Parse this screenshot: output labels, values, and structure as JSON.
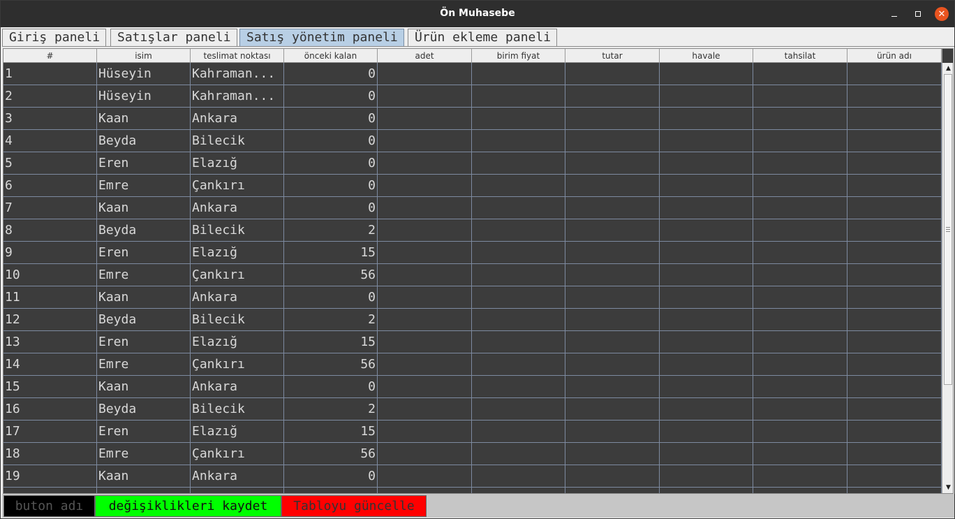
{
  "window": {
    "title": "Ön Muhasebe",
    "controls": {
      "minimize": "minimize-icon",
      "maximize": "maximize-icon",
      "close": "close-icon",
      "close_color": "#e95420"
    }
  },
  "tabs": [
    {
      "label": "Giriş paneli",
      "active": false
    },
    {
      "label": "Satışlar paneli",
      "active": false
    },
    {
      "label": "Satış yönetim paneli",
      "active": true
    },
    {
      "label": "Ürün ekleme paneli",
      "active": false
    }
  ],
  "table": {
    "columns": [
      "#",
      "isim",
      "teslimat noktası",
      "önceki kalan",
      "adet",
      "birim fiyat",
      "tutar",
      "havale",
      "tahsilat",
      "ürün adı"
    ],
    "rows": [
      [
        "1",
        "Hüseyin",
        "Kahraman...",
        "0"
      ],
      [
        "2",
        "Hüseyin",
        "Kahraman...",
        "0"
      ],
      [
        "3",
        "Kaan",
        "Ankara",
        "0"
      ],
      [
        "4",
        "Beyda",
        "Bilecik",
        "0"
      ],
      [
        "5",
        "Eren",
        "Elazığ",
        "0"
      ],
      [
        "6",
        "Emre",
        "Çankırı",
        "0"
      ],
      [
        "7",
        "Kaan",
        "Ankara",
        "0"
      ],
      [
        "8",
        "Beyda",
        "Bilecik",
        "2"
      ],
      [
        "9",
        "Eren",
        "Elazığ",
        "15"
      ],
      [
        "10",
        "Emre",
        "Çankırı",
        "56"
      ],
      [
        "11",
        "Kaan",
        "Ankara",
        "0"
      ],
      [
        "12",
        "Beyda",
        "Bilecik",
        "2"
      ],
      [
        "13",
        "Eren",
        "Elazığ",
        "15"
      ],
      [
        "14",
        "Emre",
        "Çankırı",
        "56"
      ],
      [
        "15",
        "Kaan",
        "Ankara",
        "0"
      ],
      [
        "16",
        "Beyda",
        "Bilecik",
        "2"
      ],
      [
        "17",
        "Eren",
        "Elazığ",
        "15"
      ],
      [
        "18",
        "Emre",
        "Çankırı",
        "56"
      ],
      [
        "19",
        "Kaan",
        "Ankara",
        "0"
      ]
    ],
    "scroll_position": 0.0
  },
  "buttons": {
    "button_name": "buton adı",
    "save_changes": "değişiklikleri kaydet",
    "refresh_table": "Tabloyu güncelle"
  },
  "colors": {
    "table_background": "#3c3c3c",
    "active_tab": "#b8cfe5",
    "save_button": "#00ff00",
    "refresh_button": "#ff0000",
    "name_button": "#000000"
  }
}
